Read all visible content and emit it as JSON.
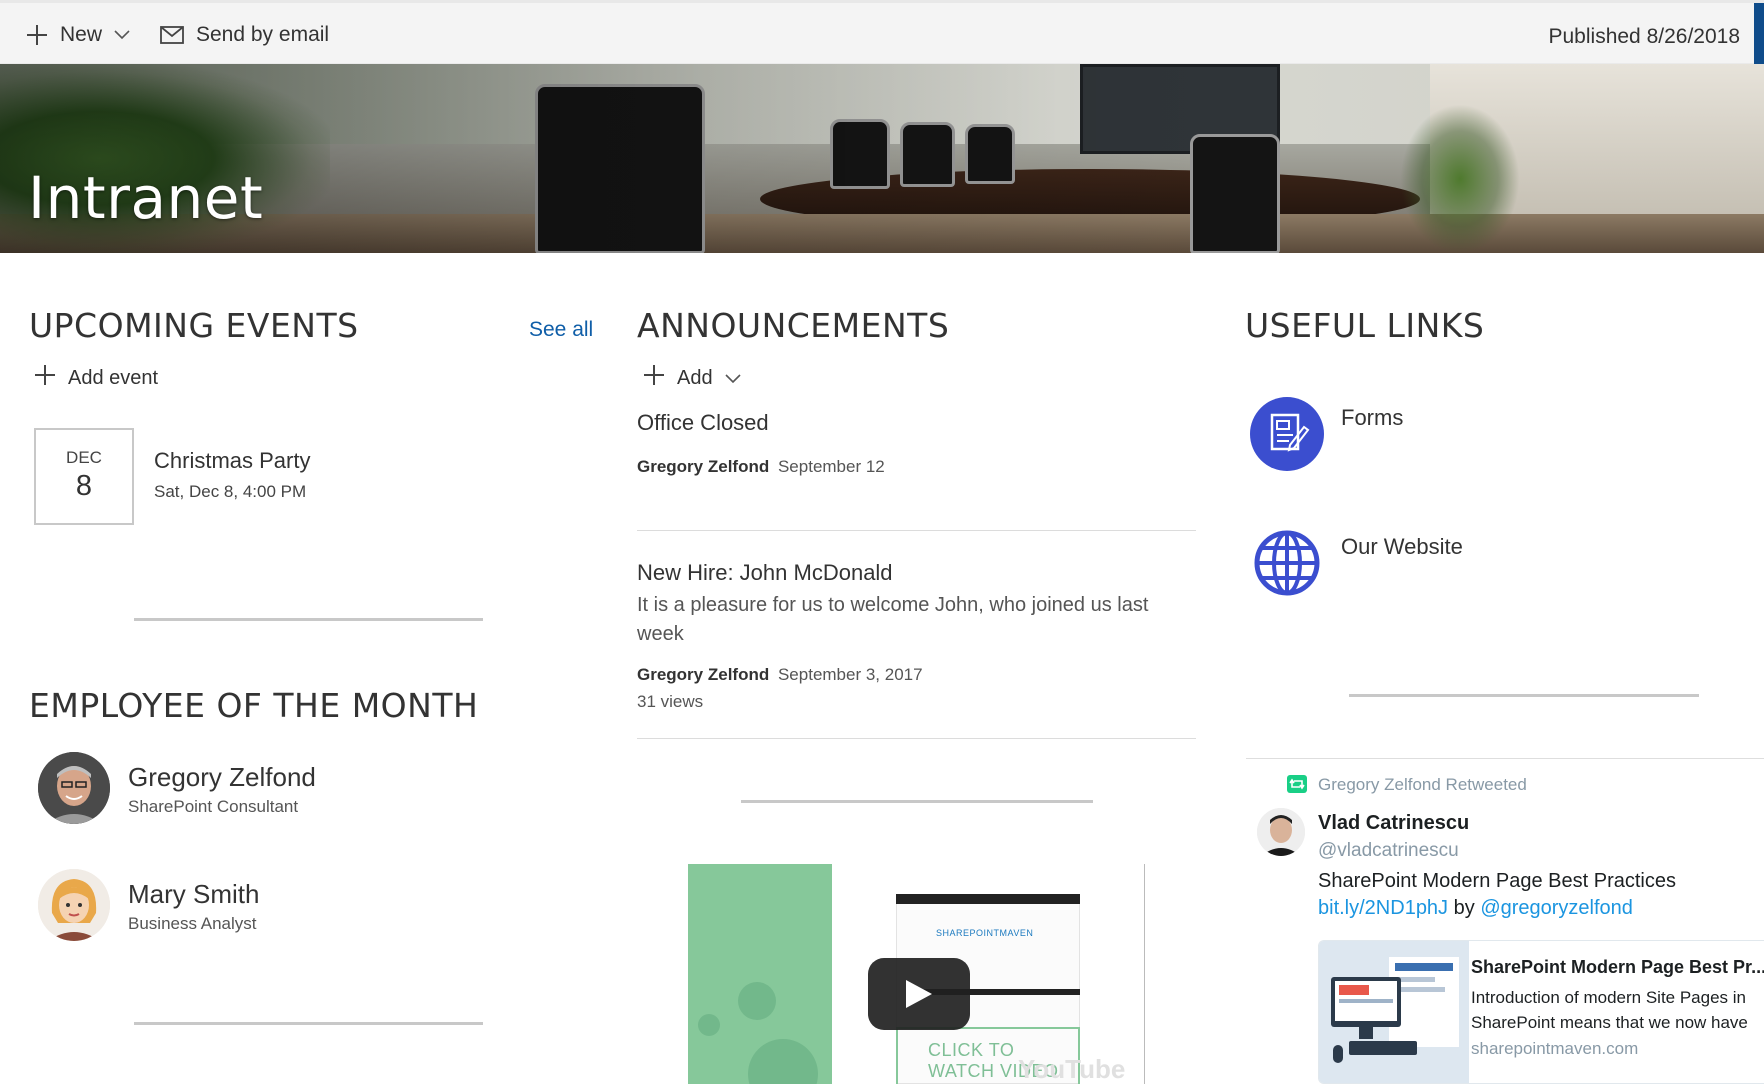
{
  "commandbar": {
    "new_label": "New",
    "email_label": "Send by email",
    "published": "Published 8/26/2018"
  },
  "hero": {
    "title": "Intranet"
  },
  "events": {
    "title": "UPCOMING EVENTS",
    "see_all": "See all",
    "add_label": "Add event",
    "items": [
      {
        "month": "DEC",
        "day": "8",
        "title": "Christmas Party",
        "time": "Sat, Dec 8, 4:00 PM"
      }
    ]
  },
  "employee": {
    "title": "EMPLOYEE OF THE MONTH",
    "people": [
      {
        "name": "Gregory Zelfond",
        "role": "SharePoint Consultant"
      },
      {
        "name": "Mary Smith",
        "role": "Business Analyst"
      }
    ]
  },
  "announcements": {
    "title": "ANNOUNCEMENTS",
    "add_label": "Add",
    "items": [
      {
        "title": "Office Closed",
        "author": "Gregory Zelfond",
        "date": "September 12"
      },
      {
        "title": "New Hire: John McDonald",
        "description": "It is a pleasure for us to welcome John, who joined us last week",
        "author": "Gregory Zelfond",
        "date": "September 3, 2017",
        "views": "31 views"
      }
    ]
  },
  "video": {
    "logo_text": "SHAREPOINTMAVEN",
    "cta_line1": "CLICK TO",
    "cta_line2": "WATCH VIDEO",
    "watermark": "YouTube"
  },
  "links": {
    "title": "USEFUL LINKS",
    "items": [
      {
        "label": "Forms",
        "icon": "forms-icon"
      },
      {
        "label": "Our Website",
        "icon": "globe-icon"
      }
    ]
  },
  "twitter": {
    "retweet_text": "Gregory Zelfond Retweeted",
    "name": "Vlad Catrinescu",
    "handle": "@vladcatrinescu",
    "text": "SharePoint Modern Page Best Practices",
    "link": "bit.ly/2ND1phJ",
    "by": "by",
    "mention": "@gregoryzelfond",
    "card": {
      "title": "SharePoint Modern Page Best Pr...",
      "desc_line1": "Introduction of modern Site Pages in",
      "desc_line2": "SharePoint means that we now have",
      "domain": "sharepointmaven.com"
    }
  },
  "colors": {
    "accent": "#0f5ea8",
    "icon_blue": "#3b4ecf",
    "twitter_blue": "#1b95e0",
    "retweet_green": "#19cf86",
    "video_green": "#86c89a"
  }
}
